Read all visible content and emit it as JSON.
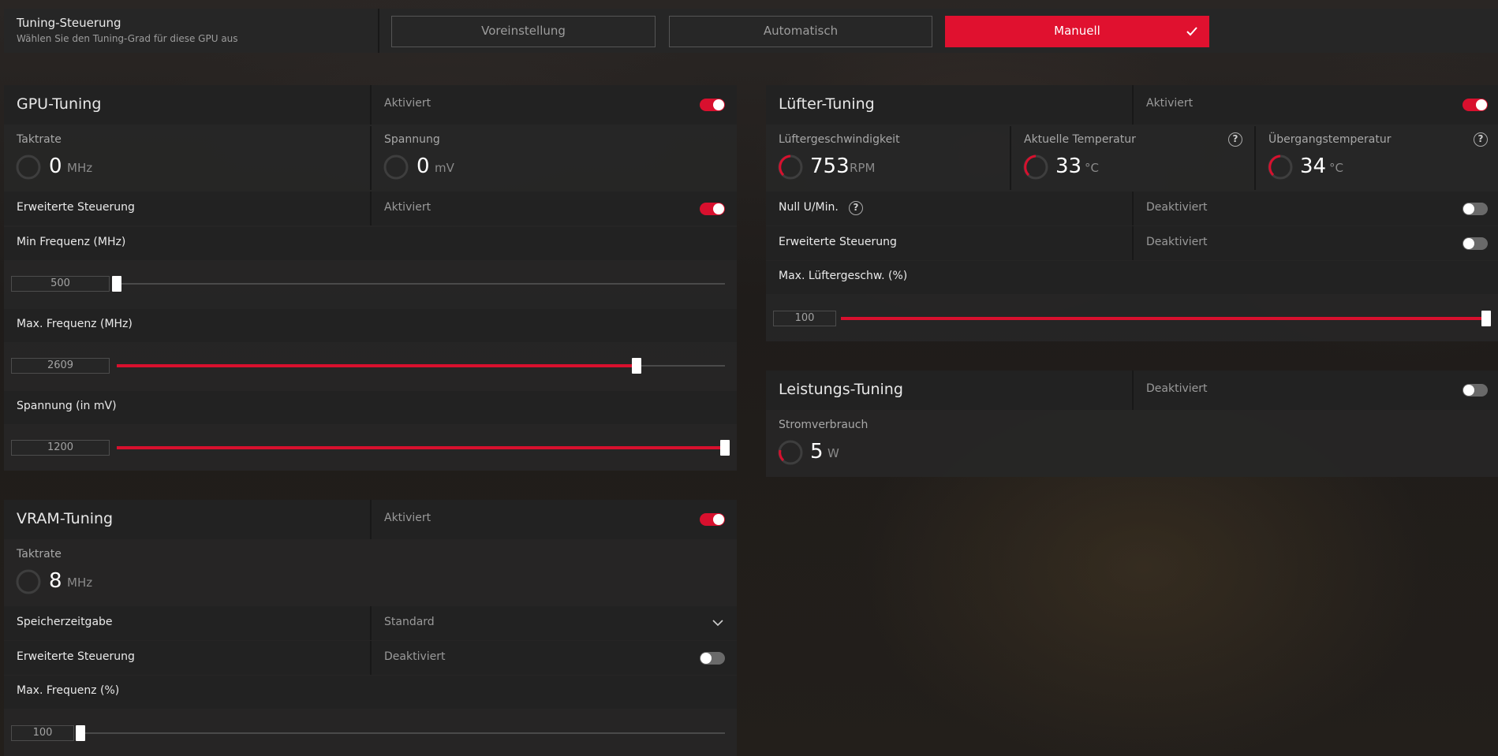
{
  "tuning_control": {
    "title": "Tuning-Steuerung",
    "subtitle": "Wählen Sie den Tuning-Grad für diese GPU aus",
    "modes": [
      "Voreinstellung",
      "Automatisch",
      "Manuell"
    ],
    "selected_mode": "Manuell"
  },
  "gpu_tuning": {
    "title": "GPU-Tuning",
    "status": "Aktiviert",
    "enabled": true,
    "clock_label": "Taktrate",
    "clock_value": "0",
    "clock_unit": "MHz",
    "voltage_label": "Spannung",
    "voltage_value": "0",
    "voltage_unit": "mV",
    "advanced_label": "Erweiterte Steuerung",
    "advanced_status": "Aktiviert",
    "advanced_enabled": true,
    "min_freq_label": "Min Frequenz (MHz)",
    "min_freq_value": "500",
    "min_freq_fraction": 0.0,
    "max_freq_label": "Max. Frequenz (MHz)",
    "max_freq_value": "2609",
    "max_freq_fraction": 0.855,
    "voltage_slider_label": "Spannung (in mV)",
    "voltage_slider_value": "1200",
    "voltage_slider_fraction": 1.0
  },
  "vram_tuning": {
    "title": "VRAM-Tuning",
    "status": "Aktiviert",
    "enabled": true,
    "clock_label": "Taktrate",
    "clock_value": "8",
    "clock_unit": "MHz",
    "timing_label": "Speicherzeitgabe",
    "timing_value": "Standard",
    "advanced_label": "Erweiterte Steuerung",
    "advanced_status": "Deaktiviert",
    "advanced_enabled": false,
    "max_freq_label": "Max. Frequenz (%)",
    "max_freq_value": "100",
    "max_freq_fraction": 0.0
  },
  "fan_tuning": {
    "title": "Lüfter-Tuning",
    "status": "Aktiviert",
    "enabled": true,
    "fan_speed_label": "Lüftergeschwindigkeit",
    "fan_speed_value": "753",
    "fan_speed_unit": "RPM",
    "current_temp_label": "Aktuelle Temperatur",
    "current_temp_value": "33",
    "current_temp_unit": "°C",
    "junction_temp_label": "Übergangstemperatur",
    "junction_temp_value": "34",
    "junction_temp_unit": "°C",
    "zero_rpm_label": "Null U/Min.",
    "zero_rpm_status": "Deaktiviert",
    "advanced_label": "Erweiterte Steuerung",
    "advanced_status": "Deaktiviert",
    "max_fan_label": "Max. Lüftergeschw. (%)",
    "max_fan_value": "100",
    "max_fan_fraction": 1.0
  },
  "power_tuning": {
    "title": "Leistungs-Tuning",
    "status": "Deaktiviert",
    "enabled": false,
    "power_label": "Stromverbrauch",
    "power_value": "5",
    "power_unit": "W"
  },
  "colors": {
    "accent": "#e0112f",
    "panel": "#262626",
    "text": "#eaeaea",
    "muted": "#9a9a9a"
  },
  "icons": [
    "checkmark-icon",
    "help-icon",
    "chevron-down-icon",
    "gauge-icon"
  ]
}
